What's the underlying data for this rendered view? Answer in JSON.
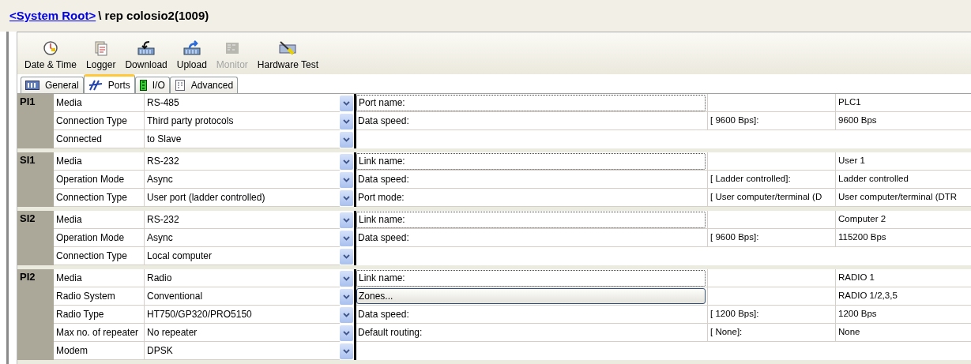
{
  "header": {
    "link": "<System Root>",
    "path": "\\ rep colosio2(1009)"
  },
  "toolbar": [
    {
      "label": "Date & Time",
      "disabled": false
    },
    {
      "label": "Logger",
      "disabled": false
    },
    {
      "label": "Download",
      "disabled": false
    },
    {
      "label": "Upload",
      "disabled": false
    },
    {
      "label": "Monitor",
      "disabled": true
    },
    {
      "label": "Hardware Test",
      "disabled": false
    }
  ],
  "tabs": [
    {
      "label": "General",
      "selected": false
    },
    {
      "label": "Ports",
      "selected": true
    },
    {
      "label": "I/O",
      "selected": false
    },
    {
      "label": "Advanced",
      "selected": false
    }
  ],
  "groups": [
    {
      "port": "PI1",
      "rows": [
        {
          "label": "Media",
          "value": "RS-485",
          "setting": {
            "kind": "field",
            "label": "Port name:",
            "current": "PLC1"
          }
        },
        {
          "label": "Connection Type",
          "value": "Third party protocols",
          "setting": {
            "kind": "plain",
            "label": "Data speed:",
            "default": "[ 9600 Bps]:",
            "current": "9600 Bps"
          }
        },
        {
          "label": "Connected",
          "value": "to Slave"
        }
      ]
    },
    {
      "port": "SI1",
      "rows": [
        {
          "label": "Media",
          "value": "RS-232",
          "setting": {
            "kind": "field",
            "label": "Link name:",
            "current": "User 1"
          }
        },
        {
          "label": "Operation Mode",
          "value": "Async",
          "setting": {
            "kind": "plain",
            "label": "Data speed:",
            "default": "[ Ladder controlled]:",
            "current": "Ladder controlled"
          }
        },
        {
          "label": "Connection Type",
          "value": "User port (ladder controlled)",
          "setting": {
            "kind": "plain",
            "label": "Port mode:",
            "default": "[ User computer/terminal (D",
            "current": "User computer/terminal (DTR"
          }
        }
      ]
    },
    {
      "port": "SI2",
      "rows": [
        {
          "label": "Media",
          "value": "RS-232",
          "setting": {
            "kind": "field",
            "label": "Link name:",
            "current": "Computer 2"
          }
        },
        {
          "label": "Operation Mode",
          "value": "Async",
          "setting": {
            "kind": "plain",
            "label": "Data speed:",
            "default": "[ 9600 Bps]:",
            "current": "115200 Bps"
          }
        },
        {
          "label": "Connection Type",
          "value": "Local computer"
        }
      ]
    },
    {
      "port": "PI2",
      "rows": [
        {
          "label": "Media",
          "value": "Radio",
          "setting": {
            "kind": "field",
            "label": "Link name:",
            "current": "RADIO 1"
          }
        },
        {
          "label": "Radio System",
          "value": "Conventional",
          "setting": {
            "kind": "button",
            "label": "Zones...",
            "current": "RADIO 1/2,3,5"
          }
        },
        {
          "label": "Radio Type",
          "value": "HT750/GP320/PRO5150",
          "setting": {
            "kind": "plain",
            "label": "Data speed:",
            "default": "[ 1200 Bps]:",
            "current": "1200 Bps"
          }
        },
        {
          "label": "Max no. of repeater",
          "value": "No repeater",
          "setting": {
            "kind": "plain",
            "label": "Default routing:",
            "default": "[ None]:",
            "current": "None"
          }
        },
        {
          "label": "Modem",
          "value": "DPSK"
        }
      ]
    }
  ]
}
